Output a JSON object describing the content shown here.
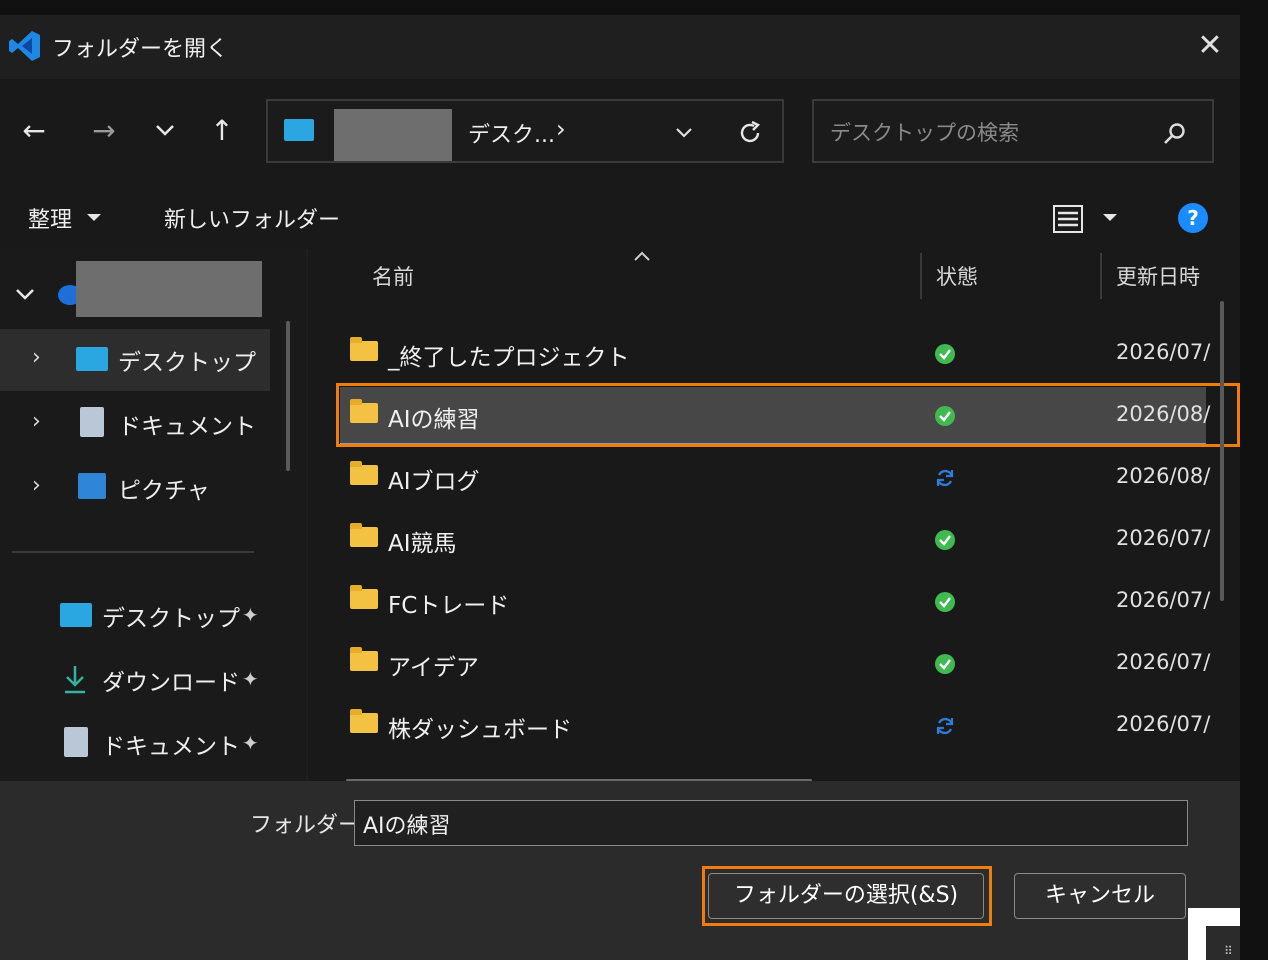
{
  "title": "フォルダーを開く",
  "nav": {
    "address_crumb": "デスク...",
    "crumb_separator": "›",
    "search_placeholder": "デスクトップの検索"
  },
  "toolbar": {
    "organize": "整理",
    "new_folder": "新しいフォルダー"
  },
  "sidebar": {
    "tree": [
      {
        "label": "デスクトップ",
        "icon": "desktop-icon",
        "selected": true
      },
      {
        "label": "ドキュメント",
        "icon": "document-icon"
      },
      {
        "label": "ピクチャ",
        "icon": "pictures-icon"
      }
    ],
    "quick": [
      {
        "label": "デスクトップ",
        "icon": "desktop-icon"
      },
      {
        "label": "ダウンロード",
        "icon": "download-icon"
      },
      {
        "label": "ドキュメント",
        "icon": "document-icon"
      }
    ]
  },
  "columns": {
    "name": "名前",
    "status": "状態",
    "modified": "更新日時"
  },
  "files": [
    {
      "name": "_終了したプロジェクト",
      "status": "synced",
      "date": "2026/07/"
    },
    {
      "name": "AIの練習",
      "status": "synced",
      "date": "2026/08/",
      "selected": true
    },
    {
      "name": "AIブログ",
      "status": "syncing",
      "date": "2026/08/"
    },
    {
      "name": "AI競馬",
      "status": "synced",
      "date": "2026/07/"
    },
    {
      "name": "FCトレード",
      "status": "synced",
      "date": "2026/07/"
    },
    {
      "name": "アイデア",
      "status": "synced",
      "date": "2026/07/"
    },
    {
      "name": "株ダッシュボード",
      "status": "syncing",
      "date": "2026/07/"
    }
  ],
  "footer": {
    "folder_label": "フォルダー:",
    "folder_value": "AIの練習",
    "select_button": "フォルダーの選択(&S)",
    "cancel_button": "キャンセル"
  },
  "colors": {
    "accent": "#f07d0a",
    "synced": "#3fb950",
    "syncing": "#2f7bd8",
    "help": "#1a8cff"
  }
}
